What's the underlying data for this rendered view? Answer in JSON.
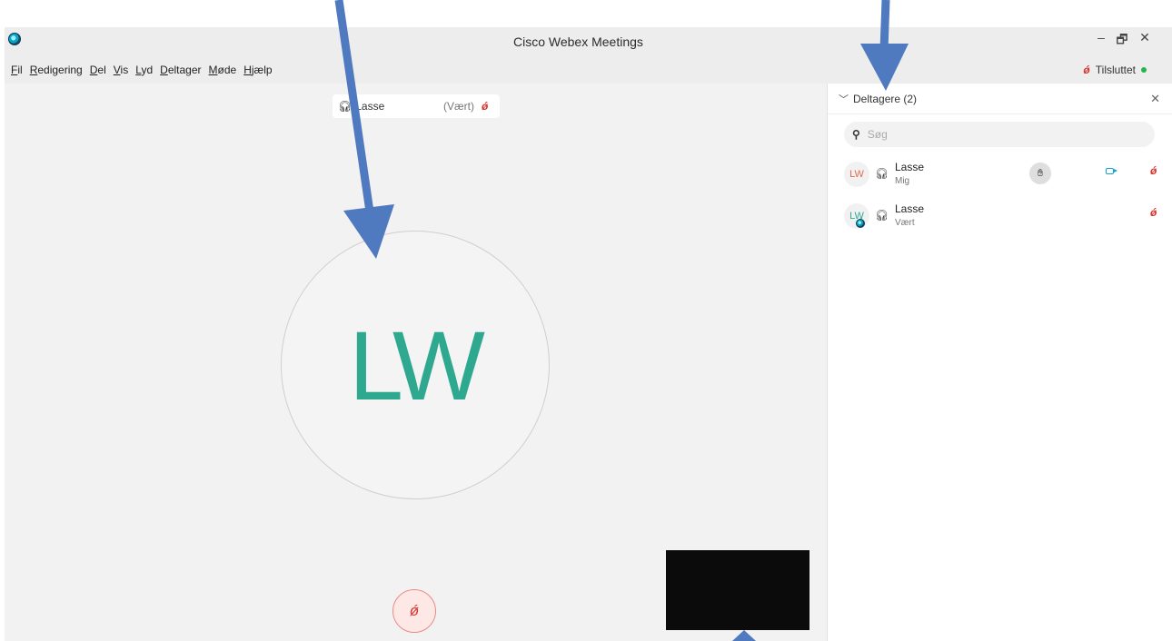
{
  "window": {
    "title": "Cisco Webex Meetings",
    "controls": {
      "minimize": "–",
      "restore": "🗗",
      "close": "✕"
    }
  },
  "menu": {
    "items": [
      {
        "first": "F",
        "rest": "il"
      },
      {
        "first": "R",
        "rest": "edigering"
      },
      {
        "first": "D",
        "rest": "el"
      },
      {
        "first": "V",
        "rest": "is"
      },
      {
        "first": "L",
        "rest": "yd"
      },
      {
        "first": "D",
        "rest": "eltager"
      },
      {
        "first": "M",
        "rest": "øde"
      },
      {
        "first": "H",
        "rest": "jælp"
      }
    ]
  },
  "connection": {
    "status": "Tilsluttet",
    "status_color": "#29b34a"
  },
  "stage": {
    "name_tag": {
      "name": "Lasse",
      "role": "(Vært)"
    },
    "avatar_initials": "LW",
    "avatar_color": "#2ea88f"
  },
  "panel": {
    "title": "Deltagere (2)",
    "search_placeholder": "Søg",
    "participants": [
      {
        "initials": "LW",
        "name": "Lasse",
        "sub": "Mig",
        "initials_color": "#e46b4b"
      },
      {
        "initials": "LW",
        "name": "Lasse",
        "sub": "Vært",
        "initials_color": "#2ea88f"
      }
    ]
  },
  "icons": {
    "headset": "headset-icon",
    "mic_muted": "mic-muted-icon",
    "search": "search-icon",
    "camera": "camera-icon",
    "raise_hand": "raise-hand-icon"
  }
}
